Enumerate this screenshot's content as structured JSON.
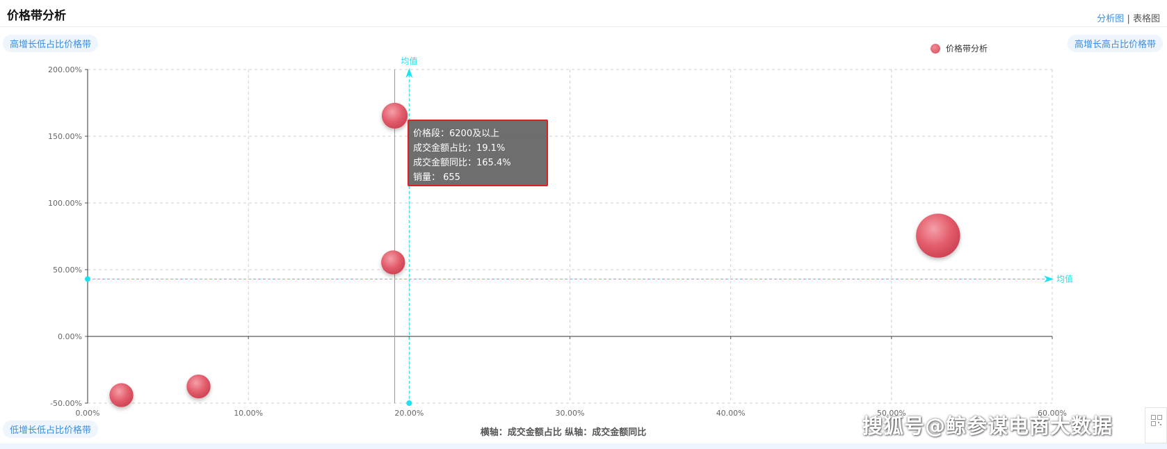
{
  "header": {
    "title": "价格带分析",
    "view_analysis": "分析图",
    "view_separator": "|",
    "view_table": "表格图"
  },
  "quadrants": {
    "top_left": "高增长低占比价格带",
    "top_right": "高增长高占比价格带",
    "bottom_left": "低增长低占比价格带"
  },
  "legend": {
    "label": "价格带分析"
  },
  "tooltip": {
    "line1": "价格段：6200及以上",
    "line2": "成交金额占比：19.1%",
    "line3": "成交金额同比：165.4%",
    "line4": "销量：  655"
  },
  "watermark": "搜狐号@鲸参谋电商大数据",
  "colors": {
    "bubble": "#e35d6c",
    "mean_line": "#18e3f0",
    "accent": "#3a8ee6"
  },
  "chart_data": {
    "type": "scatter",
    "xlabel": "横轴：成交金额占比",
    "ylabel": "纵轴：成交金额同比",
    "axis_caption": "横轴：成交金额占比  纵轴：成交金额同比",
    "xlim": [
      0,
      60
    ],
    "ylim": [
      -50,
      200
    ],
    "x_ticks": [
      0,
      10,
      20,
      30,
      40,
      50,
      60
    ],
    "y_ticks": [
      -50,
      0,
      50,
      100,
      150,
      200
    ],
    "x_tick_labels": [
      "0.00%",
      "10.00%",
      "20.00%",
      "30.00%",
      "40.00%",
      "50.00%",
      "60.00%"
    ],
    "y_tick_labels": [
      "-50.00%",
      "0.00%",
      "50.00%",
      "100.00%",
      "150.00%",
      "200.00%"
    ],
    "grid": true,
    "legend_position": "top-right",
    "mean_x": 20,
    "mean_y": 43,
    "mean_label": "均值",
    "highlight_x": 19.1,
    "series": [
      {
        "name": "价格带分析",
        "points": [
          {
            "x": 19.1,
            "y": 165.4,
            "size": 2
          },
          {
            "x": 19.0,
            "y": 55.5,
            "size": 1.5
          },
          {
            "x": 52.9,
            "y": 75.5,
            "size": 10
          },
          {
            "x": 2.1,
            "y": -44.0,
            "size": 1.5
          },
          {
            "x": 6.9,
            "y": -37.5,
            "size": 1.5
          }
        ]
      }
    ]
  }
}
